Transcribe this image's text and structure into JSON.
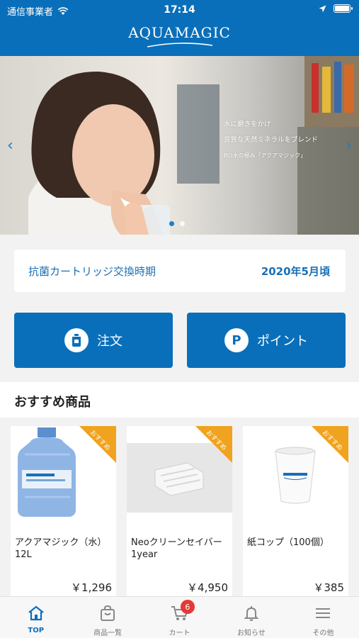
{
  "status_bar": {
    "carrier": "通信事業者",
    "time": "17:14"
  },
  "header": {
    "logo": "AQUAMAGIC"
  },
  "hero": {
    "lines": [
      "水に磨きをかけ",
      "良質な天然ミネラルをブレンド",
      "RO水の極み「アクアマジック」"
    ]
  },
  "cartridge": {
    "label": "抗菌カートリッジ交換時期",
    "value": "2020年5月頃"
  },
  "actions": {
    "order": "注文",
    "point": "ポイント",
    "point_icon": "P"
  },
  "recommended": {
    "title": "おすすめ商品",
    "badge": "おすすめ",
    "products": [
      {
        "name": "アクアマジック（水）12L",
        "price": "￥1,296"
      },
      {
        "name": "Neoクリーンセイバー1year",
        "price": "￥4,950"
      },
      {
        "name": "紙コップ（100個）",
        "price": "￥385"
      }
    ]
  },
  "tabbar": {
    "tabs": [
      {
        "label": "TOP",
        "icon": "home-icon"
      },
      {
        "label": "商品一覧",
        "icon": "bag-icon"
      },
      {
        "label": "カート",
        "icon": "cart-icon",
        "badge": "6"
      },
      {
        "label": "お知らせ",
        "icon": "bell-icon"
      },
      {
        "label": "その他",
        "icon": "menu-icon"
      }
    ]
  },
  "colors": {
    "brand_blue": "#0a6fba",
    "ribbon_orange": "#f0a31f",
    "badge_red": "#e53935"
  }
}
